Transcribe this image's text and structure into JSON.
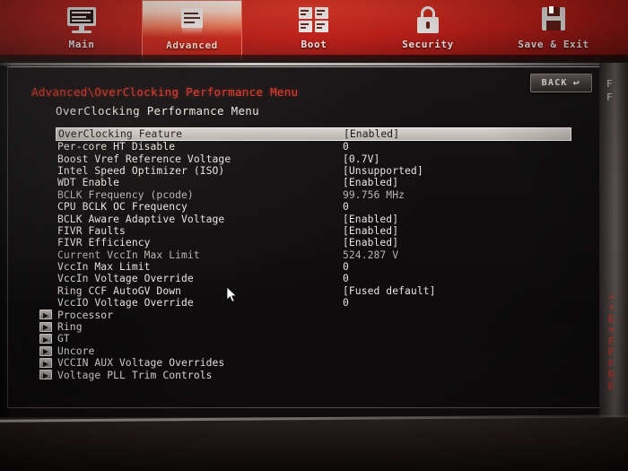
{
  "tabs": [
    {
      "label": "Main",
      "icon": "monitor-icon",
      "active": false
    },
    {
      "label": "Advanced",
      "icon": "chipcard-icon",
      "active": true
    },
    {
      "label": "Boot",
      "icon": "tiles-icon",
      "active": false
    },
    {
      "label": "Security",
      "icon": "padlock-icon",
      "active": false
    },
    {
      "label": "Save & Exit",
      "icon": "floppy-icon",
      "active": false
    }
  ],
  "header": {
    "breadcrumb": "Advanced\\OverClocking Performance Menu",
    "page_title": "OverClocking Performance Menu",
    "back_label": "BACK",
    "back_arrow": "↩"
  },
  "menu": {
    "rows": [
      {
        "label": "OverClocking Feature",
        "value": "[Enabled]",
        "selected": true,
        "submenu": false,
        "dim": false
      },
      {
        "label": "Per-core HT Disable",
        "value": "0",
        "selected": false,
        "submenu": false,
        "dim": false
      },
      {
        "label": "Boost Vref Reference Voltage",
        "value": "[0.7V]",
        "selected": false,
        "submenu": false,
        "dim": false
      },
      {
        "label": "Intel Speed Optimizer (ISO)",
        "value": "[Unsupported]",
        "selected": false,
        "submenu": false,
        "dim": false
      },
      {
        "label": "WDT Enable",
        "value": "[Enabled]",
        "selected": false,
        "submenu": false,
        "dim": false
      },
      {
        "label": "BCLK Frequency (pcode)",
        "value": "99.756 MHz",
        "selected": false,
        "submenu": false,
        "dim": true
      },
      {
        "label": "CPU BCLK OC Frequency",
        "value": "0",
        "selected": false,
        "submenu": false,
        "dim": false
      },
      {
        "label": "BCLK Aware Adaptive Voltage",
        "value": "[Enabled]",
        "selected": false,
        "submenu": false,
        "dim": false
      },
      {
        "label": "FIVR Faults",
        "value": "[Enabled]",
        "selected": false,
        "submenu": false,
        "dim": false
      },
      {
        "label": "FIVR Efficiency",
        "value": "[Enabled]",
        "selected": false,
        "submenu": false,
        "dim": false
      },
      {
        "label": "Current VccIn Max Limit",
        "value": "524.287 V",
        "selected": false,
        "submenu": false,
        "dim": true
      },
      {
        "label": "VccIn Max Limit",
        "value": "0",
        "selected": false,
        "submenu": false,
        "dim": false
      },
      {
        "label": "VccIn Voltage Override",
        "value": "0",
        "selected": false,
        "submenu": false,
        "dim": false
      },
      {
        "label": "Ring CCF AutoGV Down",
        "value": "[Fused default]",
        "selected": false,
        "submenu": false,
        "dim": false
      },
      {
        "label": "VccIO Voltage Override",
        "value": "0",
        "selected": false,
        "submenu": false,
        "dim": false
      },
      {
        "label": "Processor",
        "value": "",
        "selected": false,
        "submenu": true,
        "dim": false
      },
      {
        "label": "Ring",
        "value": "",
        "selected": false,
        "submenu": true,
        "dim": false
      },
      {
        "label": "GT",
        "value": "",
        "selected": false,
        "submenu": true,
        "dim": false
      },
      {
        "label": "Uncore",
        "value": "",
        "selected": false,
        "submenu": true,
        "dim": false
      },
      {
        "label": "VCCIN AUX Voltage Overrides",
        "value": "",
        "selected": false,
        "submenu": true,
        "dim": false
      },
      {
        "label": "Voltage PLL Trim Controls",
        "value": "",
        "selected": false,
        "submenu": true,
        "dim": false
      }
    ]
  },
  "help_panel": {
    "description_lines": "F\nF",
    "key_hints": "→\n↑\nE\n+\nF\nF\nF\nR\nE"
  },
  "colors": {
    "accent_red": "#e0392c",
    "tab_red": "#c3201a",
    "text": "#e9e5e3",
    "text_dim": "#b9b4b1",
    "selected_bg": "#c8c2be"
  }
}
